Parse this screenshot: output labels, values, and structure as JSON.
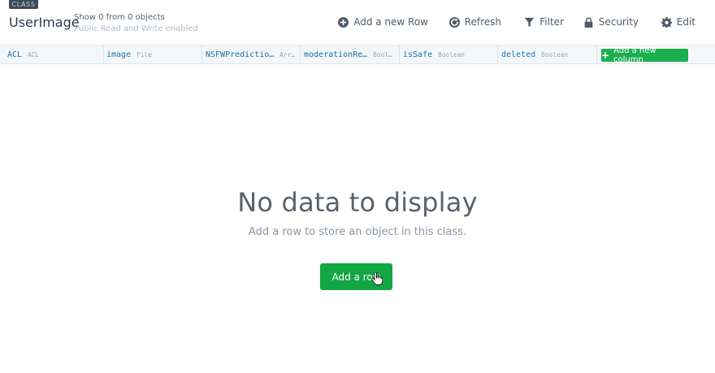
{
  "header": {
    "badge": "CLASS",
    "class_name": "UserImage",
    "count_text": "Show 0 from 0 objects",
    "permission_text": "Public Read and Write enabled"
  },
  "toolbar": {
    "add_row": "Add a new Row",
    "refresh": "Refresh",
    "filter": "Filter",
    "security": "Security",
    "edit": "Edit"
  },
  "columns": [
    {
      "name": "ACL",
      "type": "ACL"
    },
    {
      "name": "image",
      "type": "File"
    },
    {
      "name": "NSFWPredictio…",
      "type": "Arr…"
    },
    {
      "name": "moderationRe…",
      "type": "Bool…"
    },
    {
      "name": "isSafe",
      "type": "Boolean"
    },
    {
      "name": "deleted",
      "type": "Boolean"
    }
  ],
  "add_column_label": "Add a new column",
  "empty_state": {
    "title": "No data to display",
    "description": "Add a row to store an object in this class.",
    "button": "Add a row"
  },
  "colors": {
    "accent_green": "#12a644",
    "column_name": "#1a6fa8",
    "badge_bg": "#3e4a59"
  }
}
